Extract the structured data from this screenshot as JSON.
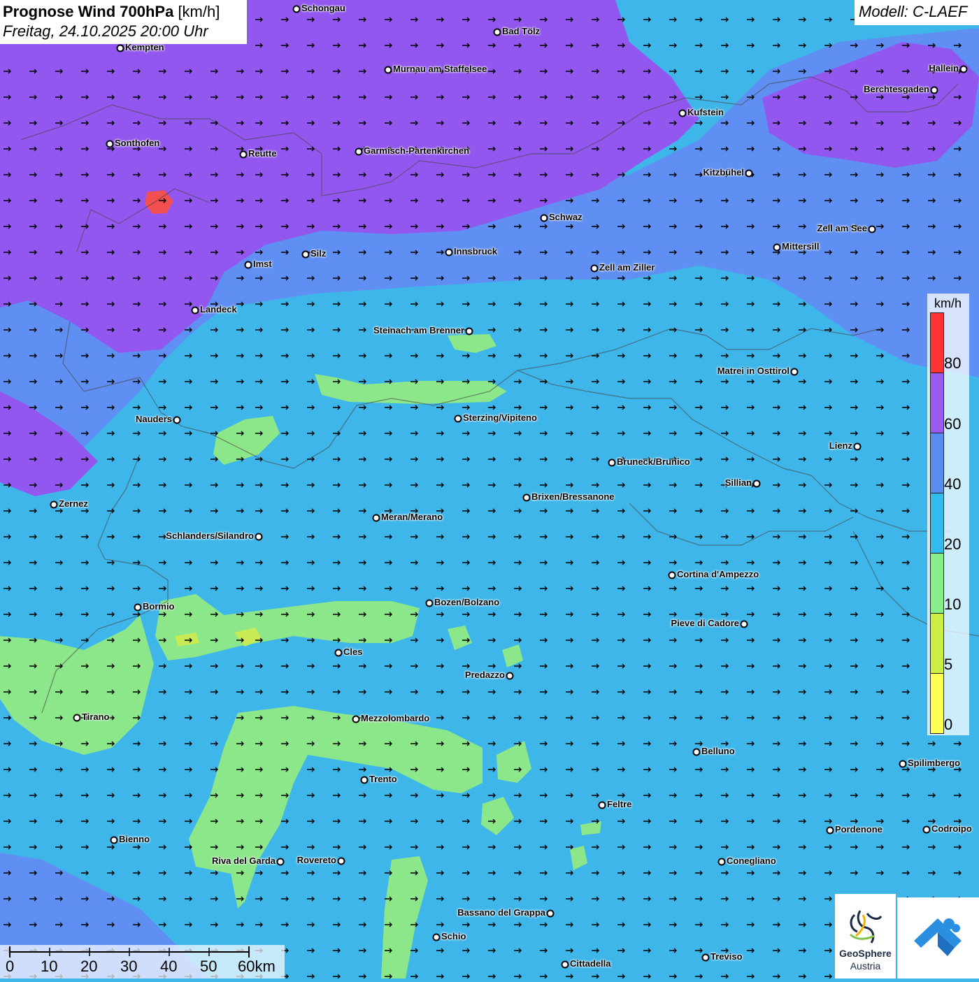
{
  "header": {
    "title": "Prognose Wind 700hPa",
    "unit": "[km/h]",
    "datetime": "Freitag, 24.10.2025 20:00 Uhr",
    "model": "Modell: C-LAEF"
  },
  "legend": {
    "unit": "km/h",
    "ticks": [
      "80",
      "60",
      "40",
      "20",
      "10",
      "5",
      "0"
    ],
    "colors": [
      "#ff3333",
      "#9b59f0",
      "#5a8cf0",
      "#33bbee",
      "#88ee88",
      "#ccee44",
      "#ffff55"
    ]
  },
  "scale_bar": {
    "labels": [
      "0",
      "10",
      "20",
      "30",
      "40",
      "50",
      "60km"
    ]
  },
  "cities": [
    {
      "name": "Schongau"
    },
    {
      "name": "Bad Tölz"
    },
    {
      "name": "Kempten"
    },
    {
      "name": "Hallein"
    },
    {
      "name": "Murnau am Staffelsee"
    },
    {
      "name": "Berchtesgaden"
    },
    {
      "name": "Kufstein"
    },
    {
      "name": "Sonthofen"
    },
    {
      "name": "Reutte"
    },
    {
      "name": "Garmisch-Partenkirchen"
    },
    {
      "name": "Kitzbühel"
    },
    {
      "name": "Schwaz"
    },
    {
      "name": "Zell am See"
    },
    {
      "name": "Mittersill"
    },
    {
      "name": "Innsbruck"
    },
    {
      "name": "Silz"
    },
    {
      "name": "Imst"
    },
    {
      "name": "Zell am Ziller"
    },
    {
      "name": "Landeck"
    },
    {
      "name": "Steinach am Brenner"
    },
    {
      "name": "Matrei in Osttirol"
    },
    {
      "name": "Nauders"
    },
    {
      "name": "Sterzing/Vipiteno"
    },
    {
      "name": "Lienz"
    },
    {
      "name": "Bruneck/Brunico"
    },
    {
      "name": "Sillian"
    },
    {
      "name": "Brixen/Bressanone"
    },
    {
      "name": "Zernez"
    },
    {
      "name": "Meran/Merano"
    },
    {
      "name": "Schlanders/Silandro"
    },
    {
      "name": "Cortina d'Ampezzo"
    },
    {
      "name": "Bozen/Bolzano"
    },
    {
      "name": "Bormio"
    },
    {
      "name": "Pieve di Cadore"
    },
    {
      "name": "Cles"
    },
    {
      "name": "Predazzo"
    },
    {
      "name": "Tirano"
    },
    {
      "name": "Mezzolombardo"
    },
    {
      "name": "Belluno"
    },
    {
      "name": "Spilimbergo"
    },
    {
      "name": "Trento"
    },
    {
      "name": "Feltre"
    },
    {
      "name": "Pordenone"
    },
    {
      "name": "Codroipo"
    },
    {
      "name": "Bienno"
    },
    {
      "name": "Riva del Garda"
    },
    {
      "name": "Rovereto"
    },
    {
      "name": "Conegliano"
    },
    {
      "name": "Bassano del Grappa"
    },
    {
      "name": "Schio"
    },
    {
      "name": "Treviso"
    },
    {
      "name": "Cittadella"
    }
  ],
  "logos": {
    "geosphere_name": "GeoSphere",
    "geosphere_sub": "Austria"
  }
}
